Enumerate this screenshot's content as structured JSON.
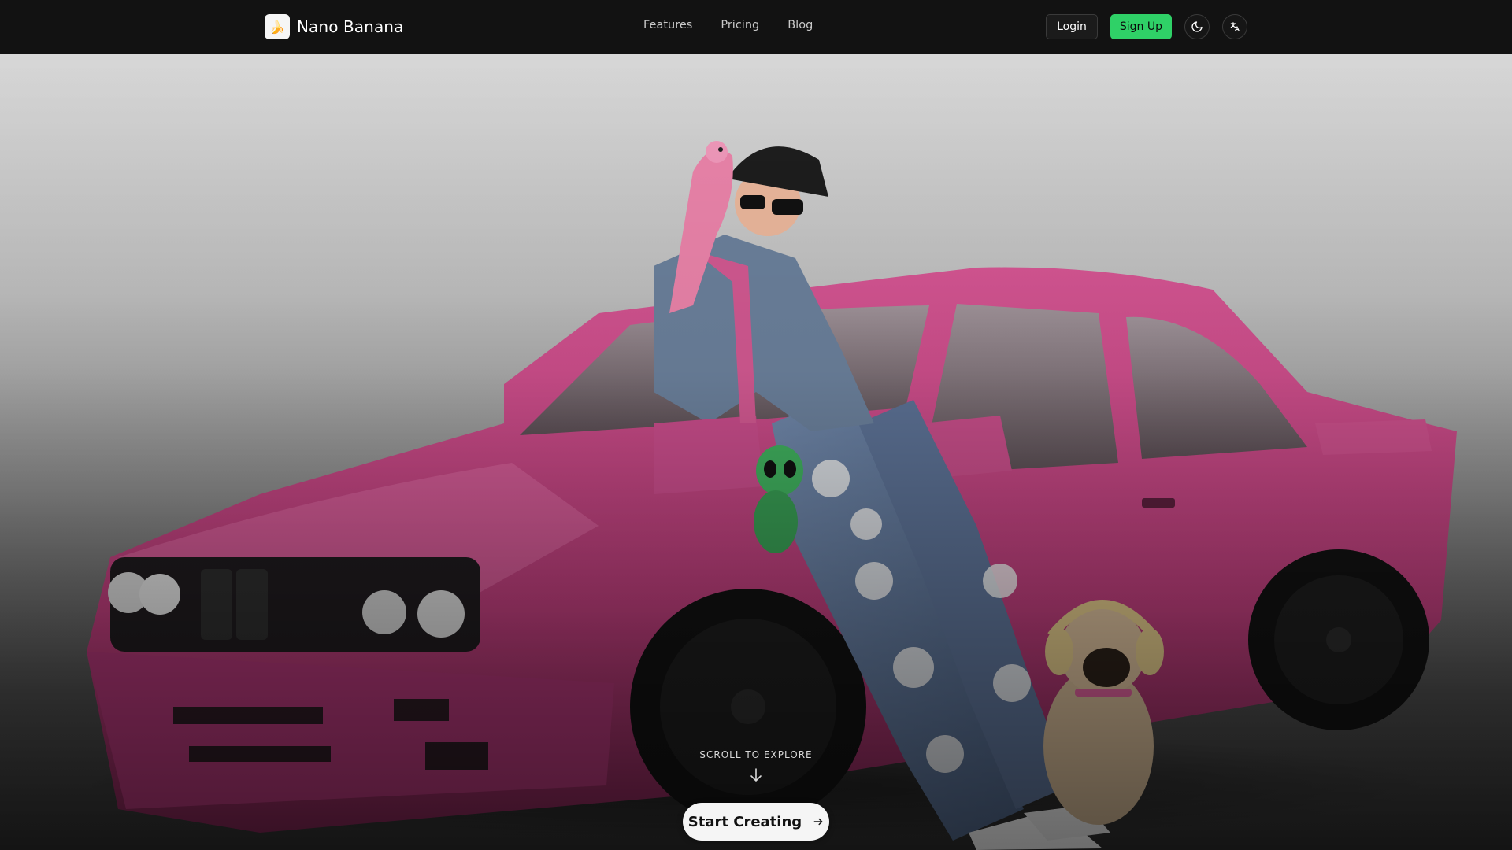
{
  "brand": {
    "name": "Nano Banana",
    "logo_icon": "banana-logo-icon"
  },
  "nav": {
    "links": [
      {
        "label": "Features"
      },
      {
        "label": "Pricing"
      },
      {
        "label": "Blog"
      }
    ]
  },
  "actions": {
    "login_label": "Login",
    "signup_label": "Sign Up",
    "theme_icon": "moon-icon",
    "language_icon": "translate-icon"
  },
  "hero": {
    "scroll_hint": "SCROLL TO EXPLORE",
    "cta_label": "Start Creating",
    "cta_icon": "arrow-right-icon"
  },
  "colors": {
    "navbar_bg": "#121212",
    "signup_accent": "#2fd167",
    "car_pink": "#c2467f",
    "parrot_pink": "#e882a8"
  }
}
